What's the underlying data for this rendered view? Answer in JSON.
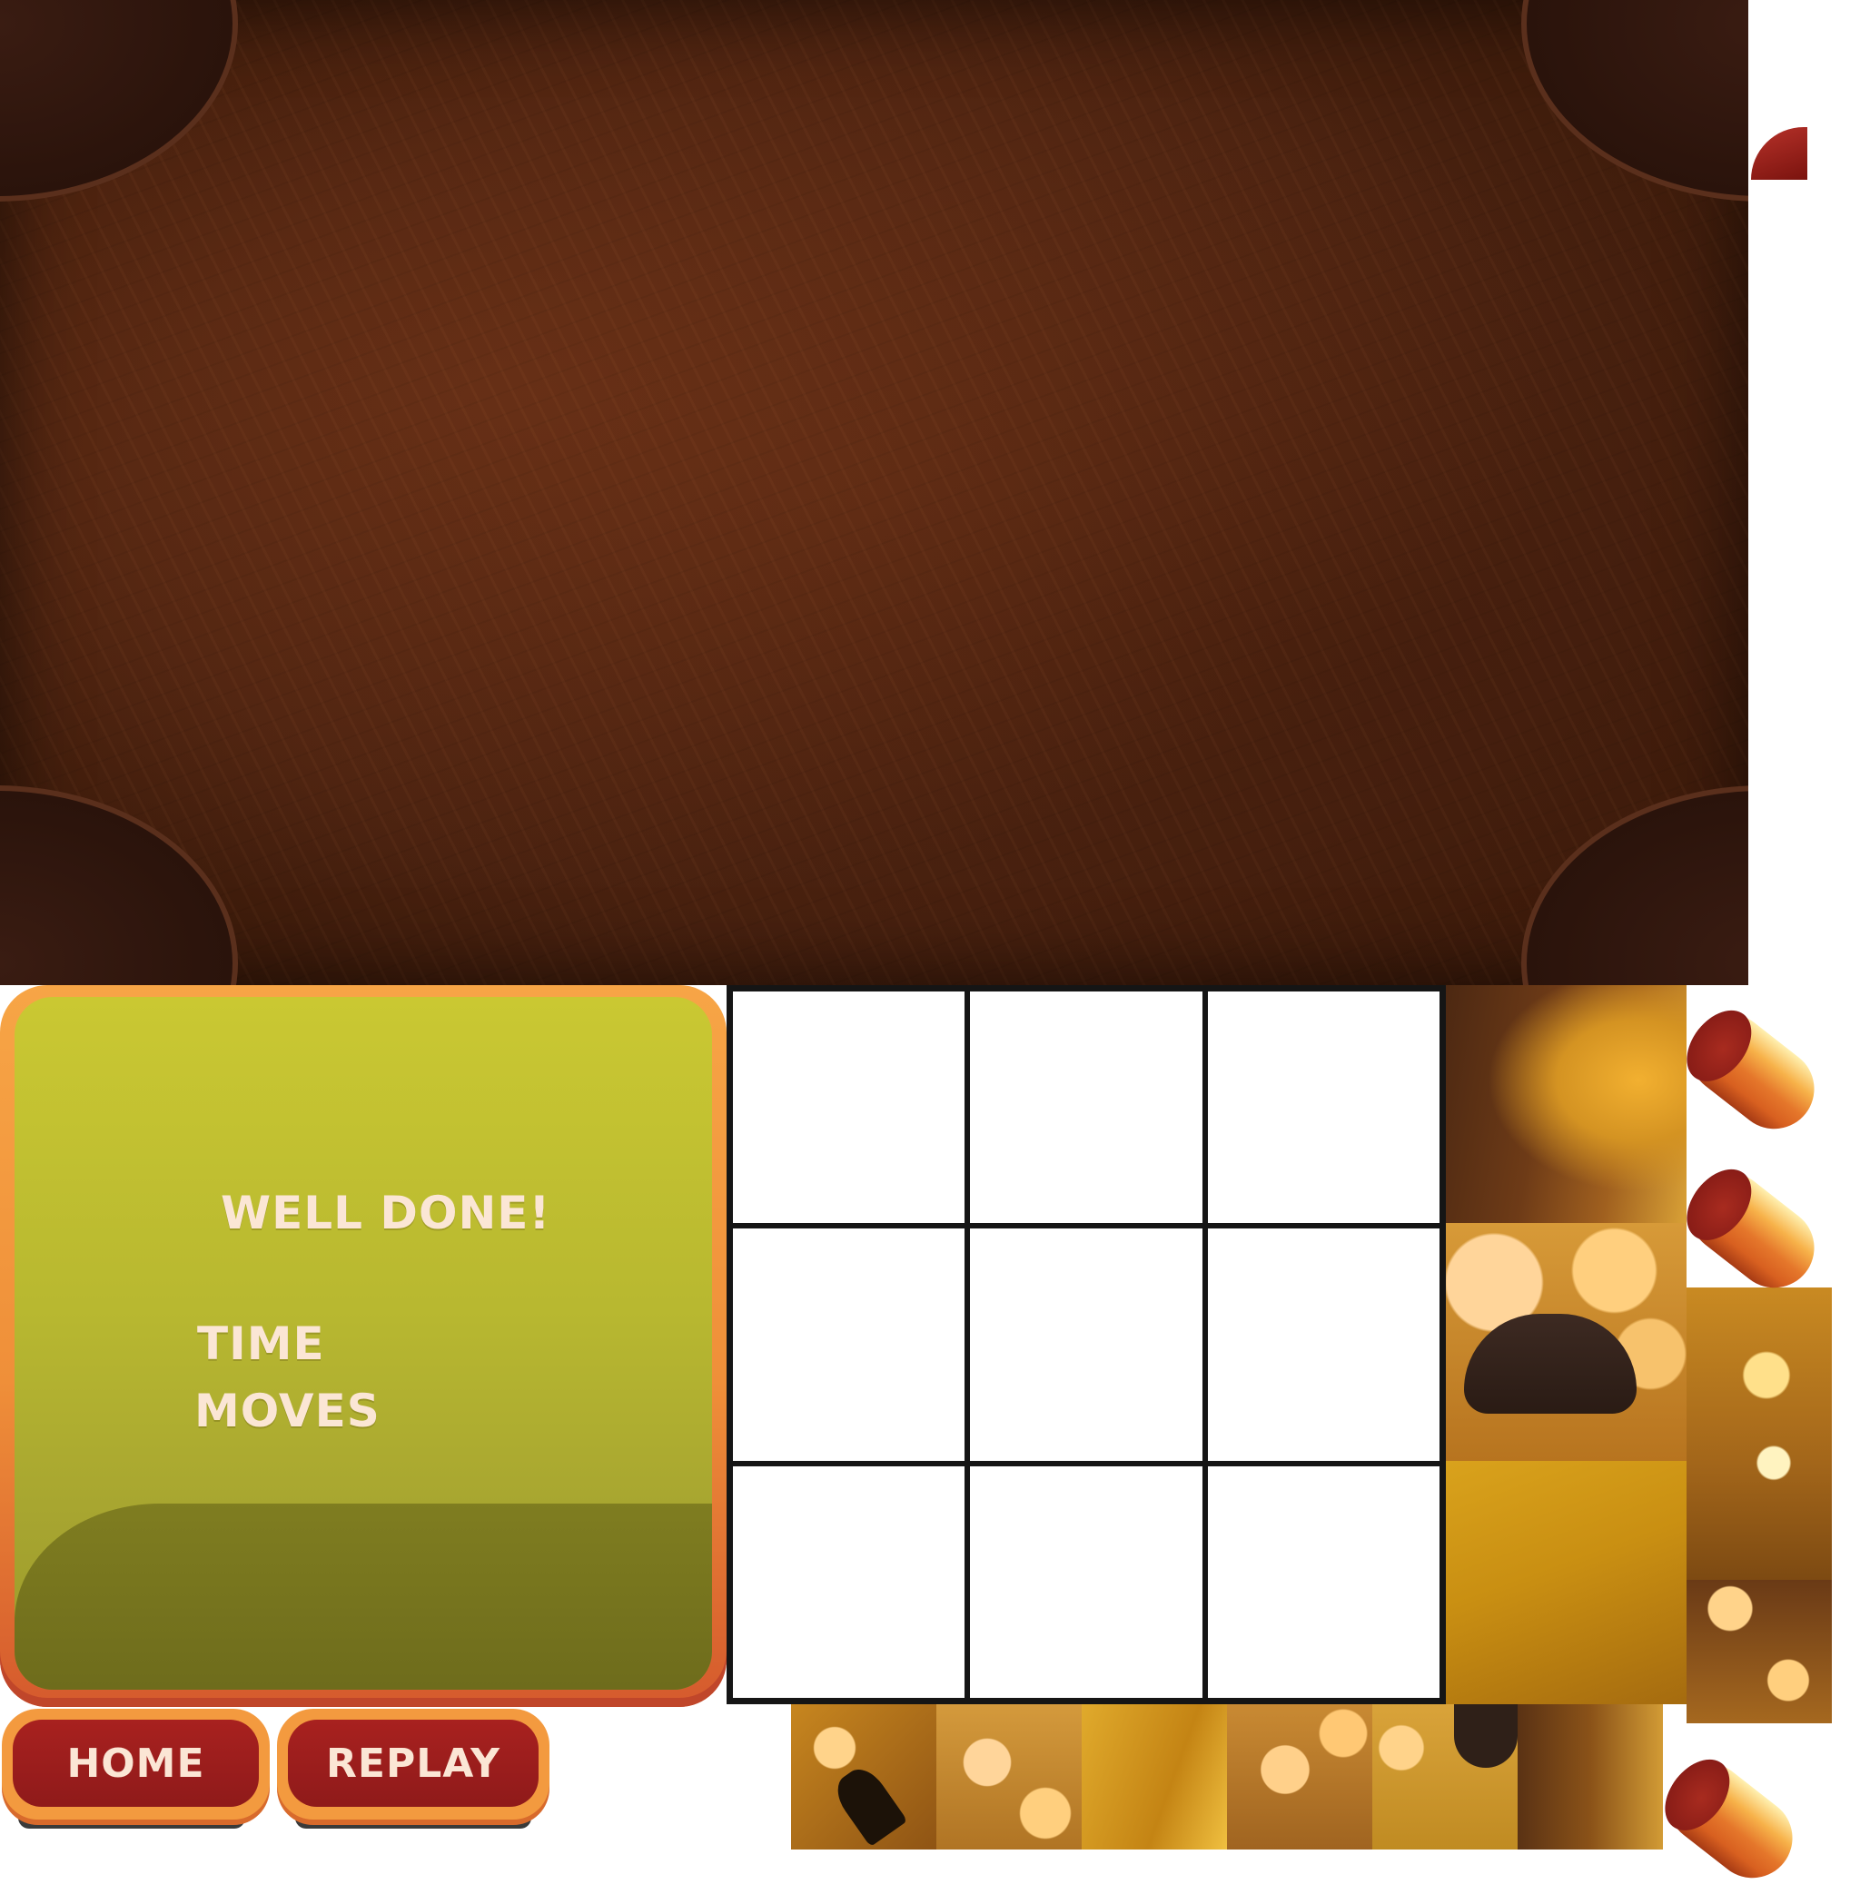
{
  "win_panel": {
    "title": "WELL DONE!",
    "time_label": "TIME",
    "moves_label": "MOVES"
  },
  "buttons": {
    "home": "HOME",
    "replay": "REPLAY"
  },
  "puzzle": {
    "rows": 3,
    "cols": 3,
    "cells": [
      "",
      "",
      "",
      "",
      "",
      "",
      "",
      "",
      ""
    ]
  },
  "colors": {
    "board": "#4a2210",
    "panel_frame": "#f39a3f",
    "panel_fill": "#b8b830",
    "button_face": "#981c1c",
    "text": "#fbe6d5"
  }
}
